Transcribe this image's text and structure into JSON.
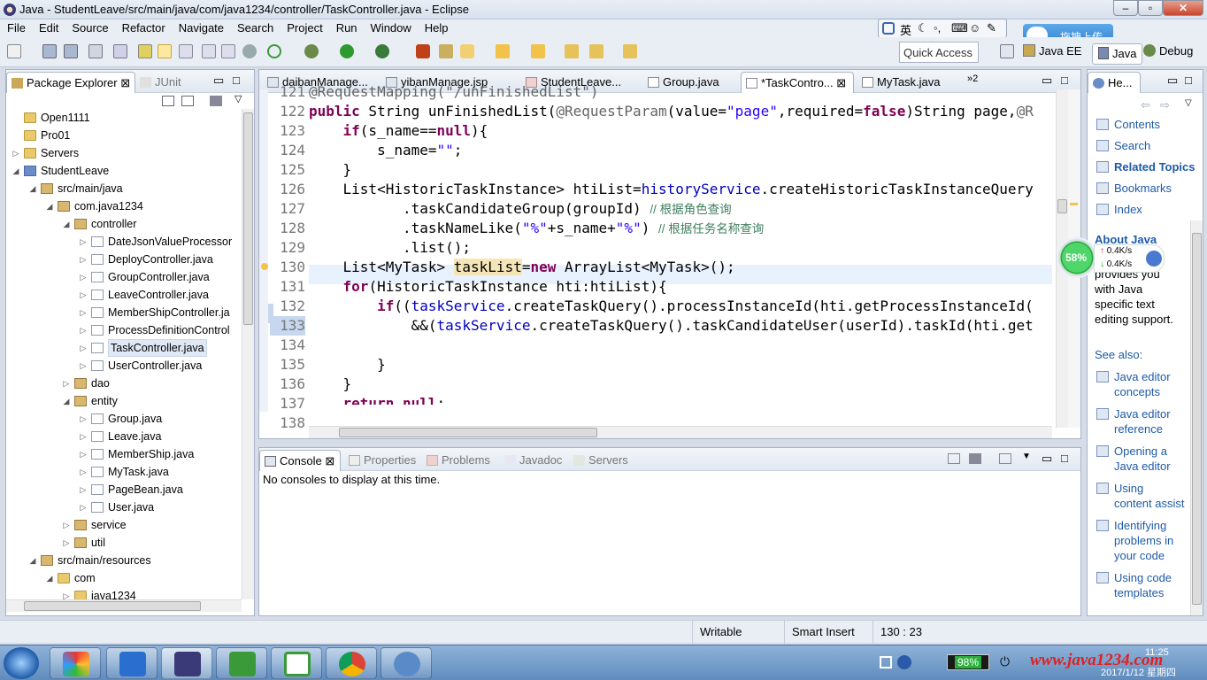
{
  "window": {
    "title": "Java - StudentLeave/src/main/java/com/java1234/controller/TaskController.java - Eclipse"
  },
  "menu": [
    "File",
    "Edit",
    "Source",
    "Refactor",
    "Navigate",
    "Search",
    "Project",
    "Run",
    "Window",
    "Help"
  ],
  "toolbar": {
    "quick_access_placeholder": "Quick Access",
    "perspective_java_ee": "Java EE",
    "perspective_java": "Java",
    "perspective_debug": "Debug",
    "upload_label": "拖拽上传",
    "ime_label": "英"
  },
  "package_explorer": {
    "tabs": [
      "Package Explorer",
      "JUnit"
    ],
    "tree": [
      {
        "label": "Open1111",
        "type": "folder",
        "level": 0,
        "arrow": ""
      },
      {
        "label": "Pro01",
        "type": "folder",
        "level": 0,
        "arrow": ""
      },
      {
        "label": "Servers",
        "type": "folder",
        "level": 0,
        "arrow": "▷"
      },
      {
        "label": "StudentLeave",
        "type": "proj",
        "level": 0,
        "arrow": "◢"
      },
      {
        "label": "src/main/java",
        "type": "pkg",
        "level": 1,
        "arrow": "◢"
      },
      {
        "label": "com.java1234",
        "type": "pkg",
        "level": 2,
        "arrow": "◢"
      },
      {
        "label": "controller",
        "type": "pkg",
        "level": 3,
        "arrow": "◢"
      },
      {
        "label": "DateJsonValueProcessor",
        "type": "java",
        "level": 4,
        "arrow": "▷"
      },
      {
        "label": "DeployController.java",
        "type": "java",
        "level": 4,
        "arrow": "▷"
      },
      {
        "label": "GroupController.java",
        "type": "java",
        "level": 4,
        "arrow": "▷"
      },
      {
        "label": "LeaveController.java",
        "type": "java",
        "level": 4,
        "arrow": "▷"
      },
      {
        "label": "MemberShipController.ja",
        "type": "java",
        "level": 4,
        "arrow": "▷"
      },
      {
        "label": "ProcessDefinitionControl",
        "type": "java",
        "level": 4,
        "arrow": "▷"
      },
      {
        "label": "TaskController.java",
        "type": "java",
        "level": 4,
        "arrow": "▷",
        "selected": true
      },
      {
        "label": "UserController.java",
        "type": "java",
        "level": 4,
        "arrow": "▷"
      },
      {
        "label": "dao",
        "type": "pkg",
        "level": 3,
        "arrow": "▷"
      },
      {
        "label": "entity",
        "type": "pkg",
        "level": 3,
        "arrow": "◢"
      },
      {
        "label": "Group.java",
        "type": "java",
        "level": 4,
        "arrow": "▷"
      },
      {
        "label": "Leave.java",
        "type": "java",
        "level": 4,
        "arrow": "▷"
      },
      {
        "label": "MemberShip.java",
        "type": "java",
        "level": 4,
        "arrow": "▷"
      },
      {
        "label": "MyTask.java",
        "type": "java",
        "level": 4,
        "arrow": "▷"
      },
      {
        "label": "PageBean.java",
        "type": "java",
        "level": 4,
        "arrow": "▷"
      },
      {
        "label": "User.java",
        "type": "java",
        "level": 4,
        "arrow": "▷"
      },
      {
        "label": "service",
        "type": "pkg",
        "level": 3,
        "arrow": "▷"
      },
      {
        "label": "util",
        "type": "pkg",
        "level": 3,
        "arrow": "▷"
      },
      {
        "label": "src/main/resources",
        "type": "pkg",
        "level": 1,
        "arrow": "◢"
      },
      {
        "label": "com",
        "type": "folder",
        "level": 2,
        "arrow": "◢"
      },
      {
        "label": "java1234",
        "type": "folder",
        "level": 3,
        "arrow": "▷"
      }
    ]
  },
  "editor": {
    "tabs": [
      "daibanManage...",
      "yibanManage.jsp",
      "StudentLeave...",
      "Group.java",
      "*TaskContro...",
      "MyTask.java"
    ],
    "overflow_count": "2",
    "line_numbers": [
      "121",
      "122",
      "123",
      "124",
      "125",
      "126",
      "127",
      "128",
      "129",
      "130",
      "131",
      "132",
      "133",
      "134",
      "135",
      "136",
      "137",
      "138"
    ],
    "current_line": "133"
  },
  "console": {
    "tabs": [
      "Console",
      "Properties",
      "Problems",
      "Javadoc",
      "Servers"
    ],
    "message": "No consoles to display at this time."
  },
  "help": {
    "tab": "He...",
    "links": [
      "Contents",
      "Search",
      "Related Topics",
      "Bookmarks",
      "Index"
    ],
    "about_heading": "About Java",
    "about_text": [
      "...editor",
      "provides you",
      "with Java",
      "specific text",
      "editing support."
    ],
    "see_also": "See also:",
    "topics": [
      [
        "Java editor",
        "concepts"
      ],
      [
        "Java editor",
        "reference"
      ],
      [
        "Opening a",
        "Java editor"
      ],
      [
        "Using",
        "content assist"
      ],
      [
        "Identifying",
        "problems in",
        "your code"
      ],
      [
        "Using code",
        "templates"
      ]
    ]
  },
  "net_widget": {
    "percent": "58%",
    "up": "0.4K/s",
    "down": "0.4K/s"
  },
  "status": {
    "writable": "Writable",
    "insert_mode": "Smart Insert",
    "position": "130 : 23"
  },
  "taskbar": {
    "battery": "98%",
    "watermark": "www.java1234.com",
    "date": "2017/1/12 星期四",
    "time": "11:25"
  },
  "colors": {
    "keyword": "#7f0055",
    "string": "#2a00ff",
    "field": "#0000c0",
    "comment": "#3f7f5f",
    "watermark": "#e02020"
  }
}
